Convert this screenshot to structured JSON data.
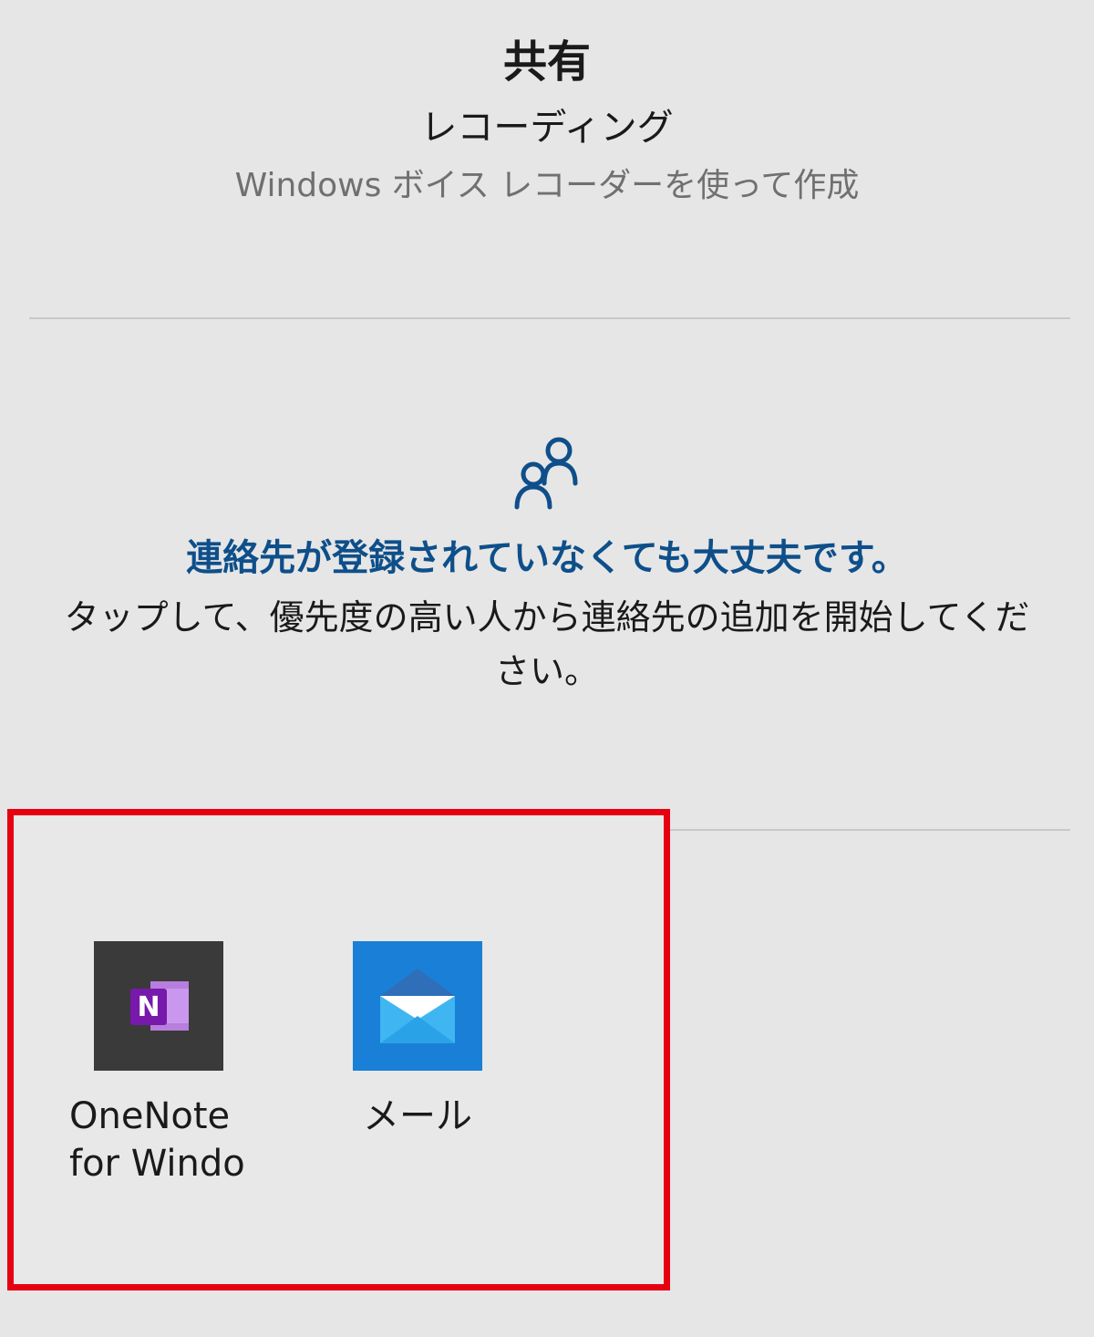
{
  "share_panel": {
    "title": "共有",
    "item_name": "レコーディング",
    "item_description": "Windows ボイス レコーダーを使って作成"
  },
  "contacts": {
    "icon": "people-icon",
    "headline": "連絡先が登録されていなくても大丈夫です。",
    "body": "タップして、優先度の高い人から連絡先の追加を開始してください。"
  },
  "share_targets": [
    {
      "icon": "onenote-icon",
      "label_line1": "OneNote",
      "label_line2": "for Windo"
    },
    {
      "icon": "mail-icon",
      "label": "メール"
    }
  ],
  "colors": {
    "background": "#e6e6e6",
    "accent_blue": "#0e4f8a",
    "highlight_red": "#e60012",
    "onenote_tile": "#3a3a3a",
    "onenote_purple": "#7719aa",
    "mail_tile": "#1a7fd6"
  }
}
